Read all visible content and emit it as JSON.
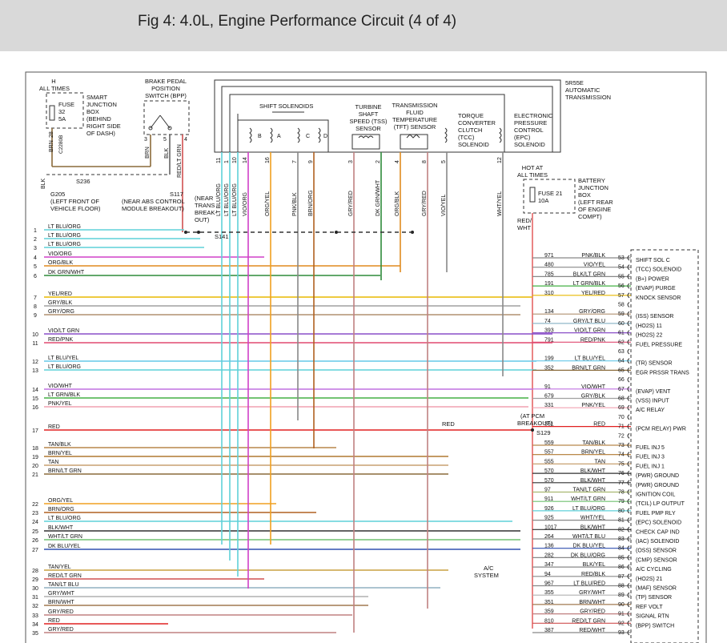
{
  "title": "Fig 4: 4.0L, Engine Performance Circuit (4 of 4)",
  "colors": {
    "LT BLU/ORG": "#5fd0d8",
    "VIO/ORG": "#d040c8",
    "ORG/BLK": "#e08a1e",
    "DK GRN/WHT": "#2e8b3a",
    "YEL/RED": "#e8b800",
    "GRY/BLK": "#a0a0a0",
    "GRY/ORG": "#b09070",
    "VIO/LT GRN": "#8a4fc8",
    "RED/PNK": "#e04a70",
    "LT BLU/YEL": "#66c8e8",
    "LT GRN/BLK": "#44b044",
    "VIO/WHT": "#c070e0",
    "PNK/YEL": "#f0a0b0",
    "RED": "#e02020",
    "TAN/BLK": "#b8864a",
    "BRN/YEL": "#b07830",
    "TAN": "#c8a070",
    "BRN/LT GRN": "#8a6a3a",
    "ORG/YEL": "#f0a020",
    "BRN/ORG": "#b06020",
    "BLK/WHT": "#303030",
    "WHT/LT GRN": "#70c070",
    "DK BLU/YEL": "#3050b0",
    "TAN/YEL": "#c8a040",
    "RED/LT GRN": "#d05050",
    "TAN/LT BLU": "#90b0c0",
    "GRY/WHT": "#b0b0b0",
    "BRN/WHT": "#a07850",
    "GRY/RED": "#c08080",
    "GRY/LT BLU": "#90b8c8",
    "LT GRN/YEL": "#90d060",
    "TAN/LT GRN": "#a8b870",
    "WHT/LT GRN2": "#88c888"
  },
  "top": {
    "hot_at_all_times": "HOT AT\nALL TIMES",
    "fuse_32": "FUSE\n32\n5A",
    "sjb": "SMART\nJUNCTION\nBOX\n(BEHIND\nRIGHT SIDE\nOF DASH)",
    "c2280b": "C2280B",
    "sjb_pin": "28",
    "brn_label": "BRN",
    "bpp": "BRAKE PEDAL\nPOSITION\nSWITCH (BPP)",
    "bpp_pins": [
      "3",
      "5",
      "4"
    ],
    "bpp_wires": [
      "BRN",
      "BLK",
      "RED/LT GRN"
    ],
    "s236": "S236",
    "blk": "BLK",
    "g205": "G205\n(LEFT FRONT OF\nVEHICLE FLOOR)",
    "s117": "S117\n(NEAR ABS CONTROL\nMODULE BREAKOUT)",
    "near_trans": "(NEAR\nTRANS\nBREAK-\nOUT)",
    "s141": "S141",
    "trans": "5R55E\nAUTOMATIC\nTRANSMISSION",
    "shift_solenoids": "SHIFT SOLENOIDS",
    "sol_letters": [
      "B",
      "A",
      "C",
      "D"
    ],
    "tss": "TURBINE\nSHAFT\nSPEED (TSS)\nSENSOR",
    "tft": "TRANSMISSION\nFLUID\nTEMPERATURE\n(TFT) SENSOR",
    "tcc": "TORQUE\nCONVERTER\nCLUTCH\n(TCC)\nSOLENOID",
    "epc": "ELECTRONIC\nPRESSURE\nCONTROL\n(EPC)\nSOLENOID",
    "trans_pins": [
      {
        "pin": "11",
        "wire": "LT BLU/ORG"
      },
      {
        "pin": "1",
        "wire": "LT BLU/ORG"
      },
      {
        "pin": "10",
        "wire": "LT BLU/ORG"
      },
      {
        "pin": "14",
        "wire": "VIO/ORG"
      },
      {
        "pin": "16",
        "wire": "ORG/YEL"
      },
      {
        "pin": "7",
        "wire": "PNK/BLK"
      },
      {
        "pin": "9",
        "wire": "BRN/ORG"
      },
      {
        "pin": "3",
        "wire": "GRY/RED"
      },
      {
        "pin": "2",
        "wire": "DK GRN/WHT"
      },
      {
        "pin": "4",
        "wire": "ORG/BLK"
      },
      {
        "pin": "8",
        "wire": "GRY/RED"
      },
      {
        "pin": "5",
        "wire": "VIO/YEL"
      },
      {
        "pin": "12",
        "wire": "WHT/YEL"
      }
    ],
    "hot2": "HOT AT\nALL TIMES",
    "fuse_21": "FUSE 21\n10A",
    "bjb": "BATTERY\nJUNCTION\nBOX\n(LEFT REAR\nOF ENGINE\nCOMPT)",
    "red_wht": "RED/\nWHT",
    "at_pcm": "(AT PCM\nBREAKOUT)",
    "s129": "S129",
    "ac_system": "A/C\nSYSTEM"
  },
  "left_rows": [
    {
      "n": "1",
      "wire": "LT BLU/ORG"
    },
    {
      "n": "2",
      "wire": "LT BLU/ORG"
    },
    {
      "n": "3",
      "wire": "LT BLU/ORG"
    },
    {
      "n": "4",
      "wire": "VIO/ORG"
    },
    {
      "n": "5",
      "wire": "ORG/BLK"
    },
    {
      "n": "6",
      "wire": "DK GRN/WHT"
    },
    {
      "n": "7",
      "wire": "YEL/RED"
    },
    {
      "n": "8",
      "wire": "GRY/BLK"
    },
    {
      "n": "9",
      "wire": "GRY/ORG"
    },
    {
      "n": "10",
      "wire": "VIO/LT GRN"
    },
    {
      "n": "11",
      "wire": "RED/PNK"
    },
    {
      "n": "12",
      "wire": "LT BLU/YEL"
    },
    {
      "n": "13",
      "wire": "LT BLU/ORG"
    },
    {
      "n": "14",
      "wire": "VIO/WHT"
    },
    {
      "n": "15",
      "wire": "LT GRN/BLK"
    },
    {
      "n": "16",
      "wire": "PNK/YEL"
    },
    {
      "n": "17",
      "wire": "RED"
    },
    {
      "n": "18",
      "wire": "TAN/BLK"
    },
    {
      "n": "19",
      "wire": "BRN/YEL"
    },
    {
      "n": "20",
      "wire": "TAN"
    },
    {
      "n": "21",
      "wire": "BRN/LT GRN"
    },
    {
      "n": "22",
      "wire": "ORG/YEL"
    },
    {
      "n": "23",
      "wire": "BRN/ORG"
    },
    {
      "n": "24",
      "wire": "LT BLU/ORG"
    },
    {
      "n": "25",
      "wire": "BLK/WHT"
    },
    {
      "n": "26",
      "wire": "WHT/LT GRN"
    },
    {
      "n": "27",
      "wire": "DK BLU/YEL"
    },
    {
      "n": "28",
      "wire": "TAN/YEL"
    },
    {
      "n": "29",
      "wire": "RED/LT GRN"
    },
    {
      "n": "30",
      "wire": "TAN/LT BLU"
    },
    {
      "n": "31",
      "wire": "GRY/WHT"
    },
    {
      "n": "32",
      "wire": "BRN/WHT"
    },
    {
      "n": "33",
      "wire": "GRY/RED"
    },
    {
      "n": "34",
      "wire": "RED"
    },
    {
      "n": "35",
      "wire": "GRY/RED"
    }
  ],
  "red_mid_label": "RED",
  "pcm_rows": [
    {
      "circuit": "971",
      "wire": "PNK/BLK",
      "pin": "53",
      "func": "SHIFT SOL C"
    },
    {
      "circuit": "480",
      "wire": "VIO/YEL",
      "pin": "54",
      "func": "(TCC) SOLENOID"
    },
    {
      "circuit": "785",
      "wire": "BLK/LT GRN",
      "pin": "55",
      "func": "(B+) POWER"
    },
    {
      "circuit": "191",
      "wire": "LT GRN/BLK",
      "pin": "56",
      "func": "(EVAP) PURGE"
    },
    {
      "circuit": "310",
      "wire": "YEL/RED",
      "pin": "57",
      "func": "KNOCK SENSOR"
    },
    {
      "circuit": "",
      "wire": "",
      "pin": "58",
      "func": ""
    },
    {
      "circuit": "134",
      "wire": "GRY/ORG",
      "pin": "59",
      "func": "(ISS) SENSOR"
    },
    {
      "circuit": "74",
      "wire": "GRY/LT BLU",
      "pin": "60",
      "func": "(HO2S) 11"
    },
    {
      "circuit": "393",
      "wire": "VIO/LT GRN",
      "pin": "61",
      "func": "(HO2S) 22"
    },
    {
      "circuit": "791",
      "wire": "RED/PNK",
      "pin": "62",
      "func": "FUEL PRESSURE"
    },
    {
      "circuit": "",
      "wire": "",
      "pin": "63",
      "func": ""
    },
    {
      "circuit": "199",
      "wire": "LT BLU/YEL",
      "pin": "64",
      "func": "(TR) SENSOR"
    },
    {
      "circuit": "352",
      "wire": "BRN/LT GRN",
      "pin": "65",
      "func": "EGR PRSSR TRANS"
    },
    {
      "circuit": "",
      "wire": "",
      "pin": "66",
      "func": ""
    },
    {
      "circuit": "91",
      "wire": "VIO/WHT",
      "pin": "67",
      "func": "(EVAP) VENT"
    },
    {
      "circuit": "679",
      "wire": "GRY/BLK",
      "pin": "68",
      "func": "(VSS) INPUT"
    },
    {
      "circuit": "331",
      "wire": "PNK/YEL",
      "pin": "69",
      "func": "A/C RELAY"
    },
    {
      "circuit": "",
      "wire": "",
      "pin": "70",
      "func": ""
    },
    {
      "circuit": "361",
      "wire": "RED",
      "pin": "71",
      "func": "(PCM RELAY) PWR"
    },
    {
      "circuit": "",
      "wire": "",
      "pin": "72",
      "func": ""
    },
    {
      "circuit": "559",
      "wire": "TAN/BLK",
      "pin": "73",
      "func": "FUEL INJ 5"
    },
    {
      "circuit": "557",
      "wire": "BRN/YEL",
      "pin": "74",
      "func": "FUEL INJ 3"
    },
    {
      "circuit": "555",
      "wire": "TAN",
      "pin": "75",
      "func": "FUEL INJ 1"
    },
    {
      "circuit": "570",
      "wire": "BLK/WHT",
      "pin": "76",
      "func": "(PWR) GROUND"
    },
    {
      "circuit": "570",
      "wire": "BLK/WHT",
      "pin": "77",
      "func": "(PWR) GROUND"
    },
    {
      "circuit": "97",
      "wire": "TAN/LT GRN",
      "pin": "78",
      "func": "IGNITION COIL"
    },
    {
      "circuit": "911",
      "wire": "WHT/LT GRN",
      "pin": "79",
      "func": "(TCIL) LP OUTPUT"
    },
    {
      "circuit": "926",
      "wire": "LT BLU/ORG",
      "pin": "80",
      "func": "FUEL PMP RLY"
    },
    {
      "circuit": "925",
      "wire": "WHT/YEL",
      "pin": "81",
      "func": "(EPC) SOLENOID"
    },
    {
      "circuit": "1017",
      "wire": "BLK/WHT",
      "pin": "82",
      "func": "CHECK CAP IND"
    },
    {
      "circuit": "264",
      "wire": "WHT/LT BLU",
      "pin": "83",
      "func": "(IAC) SOLENOID"
    },
    {
      "circuit": "136",
      "wire": "DK BLU/YEL",
      "pin": "84",
      "func": "(OSS) SENSOR"
    },
    {
      "circuit": "282",
      "wire": "DK BLU/ORG",
      "pin": "85",
      "func": "(CMP) SENSOR"
    },
    {
      "circuit": "347",
      "wire": "BLK/YEL",
      "pin": "86",
      "func": "A/C CYCLING"
    },
    {
      "circuit": "94",
      "wire": "RED/BLK",
      "pin": "87",
      "func": "(HO2S) 21"
    },
    {
      "circuit": "967",
      "wire": "LT BLU/RED",
      "pin": "88",
      "func": "(MAF) SENSOR"
    },
    {
      "circuit": "355",
      "wire": "GRY/WHT",
      "pin": "89",
      "func": "(TP) SENSOR"
    },
    {
      "circuit": "351",
      "wire": "BRN/WHT",
      "pin": "90",
      "func": "REF VOLT"
    },
    {
      "circuit": "359",
      "wire": "GRY/RED",
      "pin": "91",
      "func": "SIGNAL RTN"
    },
    {
      "circuit": "810",
      "wire": "RED/LT GRN",
      "pin": "92",
      "func": "(BPP) SWITCH"
    },
    {
      "circuit": "387",
      "wire": "RED/WHT",
      "pin": "93",
      "func": ""
    }
  ]
}
